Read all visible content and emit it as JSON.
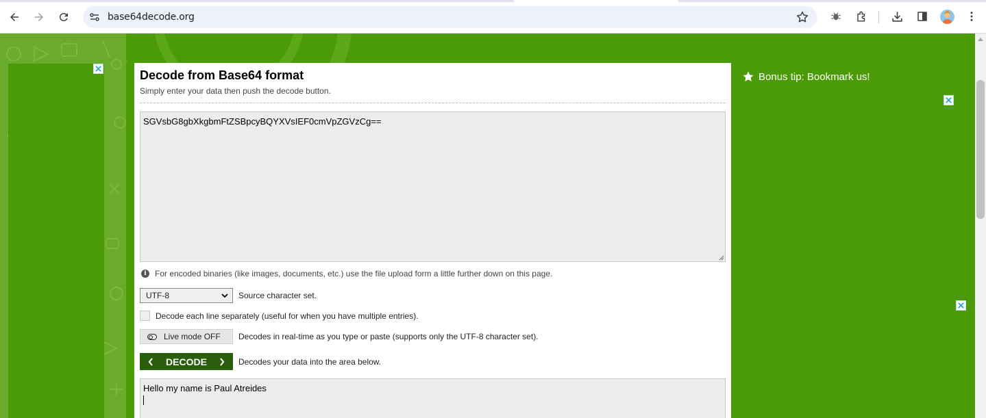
{
  "browser": {
    "url": "base64decode.org",
    "icons": [
      "back-arrow-icon",
      "forward-arrow-icon",
      "reload-icon",
      "site-info-icon",
      "bookmark-star-icon",
      "extension-bug-icon",
      "extensions-puzzle-icon",
      "download-icon",
      "side-panel-icon",
      "profile-avatar",
      "more-menu-icon"
    ]
  },
  "main": {
    "title": "Decode from Base64 format",
    "subtitle": "Simply enter your data then push the decode button.",
    "input_value": "SGVsbG8gbXkgbmFtZSBpcyBQYXVsIEF0cmVpZGVzCg==",
    "info_note": "For encoded binaries (like images, documents, etc.) use the file upload form a little further down on this page.",
    "charset": {
      "selected": "UTF-8",
      "label": "Source character set."
    },
    "line_by_line": {
      "checked": false,
      "label": "Decode each line separately (useful for when you have multiple entries)."
    },
    "live_mode": {
      "button_label": "Live mode OFF",
      "label": "Decodes in real-time as you type or paste (supports only the UTF-8 character set)."
    },
    "decode": {
      "button_label": "DECODE",
      "label": "Decodes your data into the area below."
    },
    "output_value": "Hello my name is Paul Atreides"
  },
  "sidebar": {
    "bonus_tip": "Bonus tip: Bookmark us!"
  },
  "colors": {
    "brand_green": "#4a9b06",
    "decode_button": "#2b5e0c",
    "textarea_bg": "#ececec"
  }
}
